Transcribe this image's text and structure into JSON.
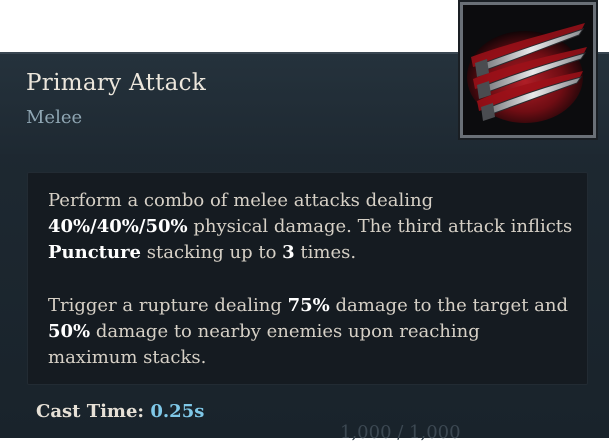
{
  "skill": {
    "name": "Primary Attack",
    "type": "Melee",
    "icon": "claw-slash-icon"
  },
  "description": {
    "p1": {
      "t1": "Perform a combo of melee attacks dealing ",
      "h1": "40%/40%/50%",
      "t2": " physical damage. The third attack inflicts ",
      "h2": "Puncture",
      "t3": " stacking up to ",
      "h3": "3",
      "t4": " times."
    },
    "p2": {
      "t1": "Trigger a rupture dealing ",
      "h1": "75%",
      "t2": " damage to the target and ",
      "h2": "50%",
      "t3": " damage to nearby enemies upon reaching maximum stacks."
    }
  },
  "stats": {
    "cast_time_label": "Cast Time:",
    "cast_time_value": "0.25s"
  },
  "partial_text": "1,000 / 1,000",
  "colors": {
    "panel": "#1f2a33",
    "highlight": "#ffffff",
    "value": "#7fc8e8",
    "subtitle": "#8fa6b3"
  }
}
